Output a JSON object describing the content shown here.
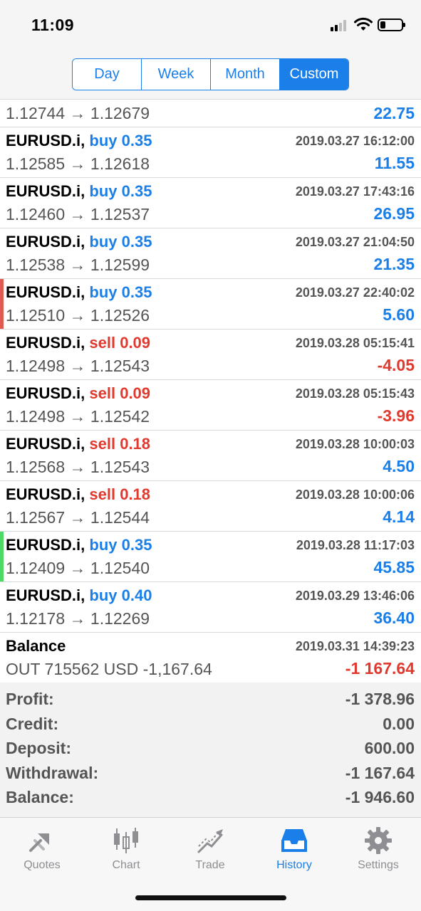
{
  "status": {
    "time": "11:09"
  },
  "periods": [
    {
      "label": "Day",
      "active": false
    },
    {
      "label": "Week",
      "active": false
    },
    {
      "label": "Month",
      "active": false
    },
    {
      "label": "Custom",
      "active": true
    }
  ],
  "first_row": {
    "prices": "1.12744 → 1.12679",
    "profit": "22.75",
    "profit_sign": "pos"
  },
  "deals": [
    {
      "symbol": "EURUSD.i,",
      "side": "buy",
      "volume": "0.35",
      "time": "2019.03.27 16:12:00",
      "prices": "1.12585 → 1.12618",
      "profit": "11.55",
      "profit_sign": "pos",
      "marker": ""
    },
    {
      "symbol": "EURUSD.i,",
      "side": "buy",
      "volume": "0.35",
      "time": "2019.03.27 17:43:16",
      "prices": "1.12460 → 1.12537",
      "profit": "26.95",
      "profit_sign": "pos",
      "marker": ""
    },
    {
      "symbol": "EURUSD.i,",
      "side": "buy",
      "volume": "0.35",
      "time": "2019.03.27 21:04:50",
      "prices": "1.12538 → 1.12599",
      "profit": "21.35",
      "profit_sign": "pos",
      "marker": ""
    },
    {
      "symbol": "EURUSD.i,",
      "side": "buy",
      "volume": "0.35",
      "time": "2019.03.27 22:40:02",
      "prices": "1.12510 → 1.12526",
      "profit": "5.60",
      "profit_sign": "pos",
      "marker": "#e05a4f"
    },
    {
      "symbol": "EURUSD.i,",
      "side": "sell",
      "volume": "0.09",
      "time": "2019.03.28 05:15:41",
      "prices": "1.12498 → 1.12543",
      "profit": "-4.05",
      "profit_sign": "neg",
      "marker": ""
    },
    {
      "symbol": "EURUSD.i,",
      "side": "sell",
      "volume": "0.09",
      "time": "2019.03.28 05:15:43",
      "prices": "1.12498 → 1.12542",
      "profit": "-3.96",
      "profit_sign": "neg",
      "marker": ""
    },
    {
      "symbol": "EURUSD.i,",
      "side": "sell",
      "volume": "0.18",
      "time": "2019.03.28 10:00:03",
      "prices": "1.12568 → 1.12543",
      "profit": "4.50",
      "profit_sign": "pos",
      "marker": ""
    },
    {
      "symbol": "EURUSD.i,",
      "side": "sell",
      "volume": "0.18",
      "time": "2019.03.28 10:00:06",
      "prices": "1.12567 → 1.12544",
      "profit": "4.14",
      "profit_sign": "pos",
      "marker": ""
    },
    {
      "symbol": "EURUSD.i,",
      "side": "buy",
      "volume": "0.35",
      "time": "2019.03.28 11:17:03",
      "prices": "1.12409 → 1.12540",
      "profit": "45.85",
      "profit_sign": "pos",
      "marker": "#4cd964"
    },
    {
      "symbol": "EURUSD.i,",
      "side": "buy",
      "volume": "0.40",
      "time": "2019.03.29 13:46:06",
      "prices": "1.12178 → 1.12269",
      "profit": "36.40",
      "profit_sign": "pos",
      "marker": ""
    }
  ],
  "balance_op": {
    "title": "Balance",
    "time": "2019.03.31 14:39:23",
    "comment": "OUT 715562 USD -1,167.64",
    "amount": "-1 167.64",
    "amount_sign": "neg"
  },
  "summary": [
    {
      "label": "Profit:",
      "value": "-1 378.96"
    },
    {
      "label": "Credit:",
      "value": "0.00"
    },
    {
      "label": "Deposit:",
      "value": "600.00"
    },
    {
      "label": "Withdrawal:",
      "value": "-1 167.64"
    },
    {
      "label": "Balance:",
      "value": "-1 946.60"
    }
  ],
  "tabs": [
    {
      "label": "Quotes",
      "icon": "quotes-icon",
      "active": false
    },
    {
      "label": "Chart",
      "icon": "chart-icon",
      "active": false
    },
    {
      "label": "Trade",
      "icon": "trade-icon",
      "active": false
    },
    {
      "label": "History",
      "icon": "history-icon",
      "active": true
    },
    {
      "label": "Settings",
      "icon": "settings-icon",
      "active": false
    }
  ],
  "colors": {
    "accent": "#1a7fe8",
    "negative": "#e03a2f",
    "icon_gray": "#8e8e93"
  }
}
